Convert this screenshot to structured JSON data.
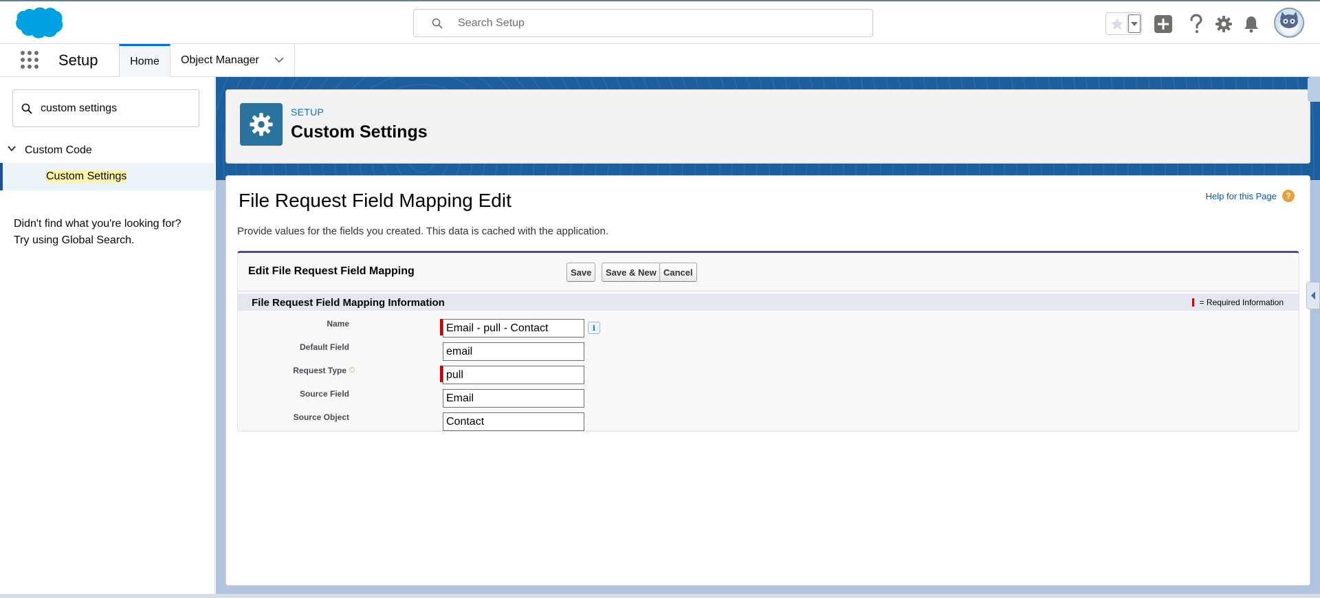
{
  "global_header": {
    "search_placeholder": "Search Setup"
  },
  "context_bar": {
    "app_name": "Setup",
    "tabs": [
      {
        "label": "Home"
      },
      {
        "label": "Object Manager"
      }
    ]
  },
  "sidebar": {
    "quickfind_value": "custom settings",
    "tree": {
      "node_label": "Custom Code",
      "leaf_label": "Custom Settings"
    },
    "not_found_line1": "Didn't find what you're looking for?",
    "not_found_line2": "Try using Global Search."
  },
  "page_header": {
    "eyebrow": "SETUP",
    "title": "Custom Settings"
  },
  "content": {
    "title": "File Request Field Mapping Edit",
    "help_link": "Help for this Page",
    "description": "Provide values for the fields you created. This data is cached with the application.",
    "block_title": "Edit File Request Field Mapping",
    "buttons": {
      "save": "Save",
      "save_new": "Save & New",
      "cancel": "Cancel"
    },
    "section_title": "File Request Field Mapping Information",
    "required_legend": "= Required Information",
    "fields": [
      {
        "label": "Name",
        "value": "Email - pull - Contact",
        "required": true
      },
      {
        "label": "Default Field",
        "value": "email",
        "required": false
      },
      {
        "label": "Request Type",
        "value": "pull",
        "required": true
      },
      {
        "label": "Source Field",
        "value": "Email",
        "required": false
      },
      {
        "label": "Source Object",
        "value": "Contact",
        "required": false
      }
    ]
  },
  "colors": {
    "brand_blue": "#0070d2",
    "header_icon_bg": "#2a739e",
    "required_red": "#cc0000",
    "block_accent": "#56458c"
  }
}
